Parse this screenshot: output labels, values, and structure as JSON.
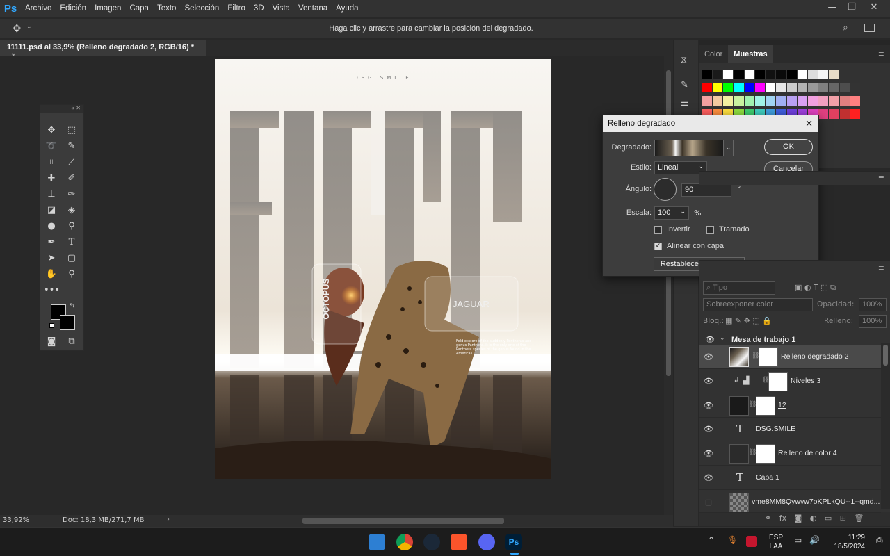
{
  "app": {
    "logo": "Ps"
  },
  "menu": [
    "Archivo",
    "Edición",
    "Imagen",
    "Capa",
    "Texto",
    "Selección",
    "Filtro",
    "3D",
    "Vista",
    "Ventana",
    "Ayuda"
  ],
  "options_bar": {
    "hint": "Haga clic y arrastre para cambiar la posición del degradado."
  },
  "document": {
    "tab_title": "11111.psd al 33,9% (Relleno degradado 2, RGB/16) *",
    "tab_close": "×"
  },
  "status": {
    "zoom": "33,92%",
    "doc_info": "Doc: 18,3 MB/271,7 MB"
  },
  "artwork": {
    "top_text": "DSG.SMILE",
    "label_left": "OCTOPUS",
    "label_right": "JAGUAR",
    "small_caption": "Feld explore of the suddenly Pantheras and genus Panthera. It is the only one of the Panthera species of the genus found in the Americas"
  },
  "panels": {
    "tabs": [
      "Color",
      "Muestras"
    ],
    "active_tab": "Muestras"
  },
  "swatches": [
    [
      "#000000",
      "#1a1a1a",
      "#ffffff",
      "#000000",
      "#ffffff",
      "#000000",
      "#111111",
      "#0a0a0a",
      "#000000",
      "#ffffff",
      "#dcdcdc",
      "#f4f4f4",
      "#e8dcc8"
    ],
    [
      "#ff0000",
      "#ffff00",
      "#00ff00",
      "#00ffff",
      "#0000ff",
      "#ff00ff",
      "#ffffff",
      "#e6e6e6",
      "#cccccc",
      "#b3b3b3",
      "#999999",
      "#808080",
      "#666666",
      "#4d4d4d",
      "#333333"
    ],
    [
      "#f2a0a0",
      "#f2c9a0",
      "#f2f0a0",
      "#c9f2a0",
      "#a0f2b0",
      "#a0f2e6",
      "#a0d4f2",
      "#a0b0f2",
      "#b8a0f2",
      "#d8a0f2",
      "#f2a0e0",
      "#f2a0c0",
      "#f2a0a8",
      "#e08080",
      "#ff8080"
    ],
    [
      "#ff6060",
      "#ff9040",
      "#ffe040",
      "#90e040",
      "#40d070",
      "#40d0c0",
      "#40a0e0",
      "#4060e0",
      "#7040e0",
      "#a040e0",
      "#e040c0",
      "#e04080",
      "#e04060",
      "#c03030",
      "#ff2020"
    ]
  ],
  "gradient_dialog": {
    "title": "Relleno degradado",
    "close": "✕",
    "gradient_label": "Degradado:",
    "style_label": "Estilo:",
    "style_value": "Lineal",
    "angle_label": "Ángulo:",
    "angle_value": "90",
    "angle_unit": "°",
    "scale_label": "Escala:",
    "scale_value": "100",
    "scale_unit": "%",
    "invert_label": "Invertir",
    "invert_checked": false,
    "dither_label": "Tramado",
    "dither_checked": false,
    "align_label": "Alinear con capa",
    "align_checked": true,
    "reset_label": "Restablecer alineación",
    "ok_label": "OK",
    "cancel_label": "Cancelar"
  },
  "layers_panel": {
    "kind_placeholder": "Tipo",
    "blend_mode": "Sobreexponer color",
    "opacity_label": "Opacidad:",
    "opacity_value": "100%",
    "lock_label": "Bloq.:",
    "fill_label": "Relleno:",
    "fill_value": "100%",
    "artboard_name": "Mesa de trabajo 1",
    "layers": [
      {
        "name": "Relleno degradado 2",
        "selected": true
      },
      {
        "name": "Niveles 3",
        "selected": false
      },
      {
        "name": "12",
        "selected": false
      },
      {
        "name": "DSG.SMILE",
        "selected": false
      },
      {
        "name": "Relleno de color 4",
        "selected": false
      },
      {
        "name": "Capa 1",
        "selected": false
      },
      {
        "name": "vme8MM8Qywvw7oKPLkQU--1--qmd...",
        "selected": false
      }
    ]
  },
  "taskbar": {
    "lang": "ESP",
    "lang_sub": "LAA",
    "time": "11:29",
    "date": "18/5/2024",
    "accent_ps": "#31a8ff"
  }
}
